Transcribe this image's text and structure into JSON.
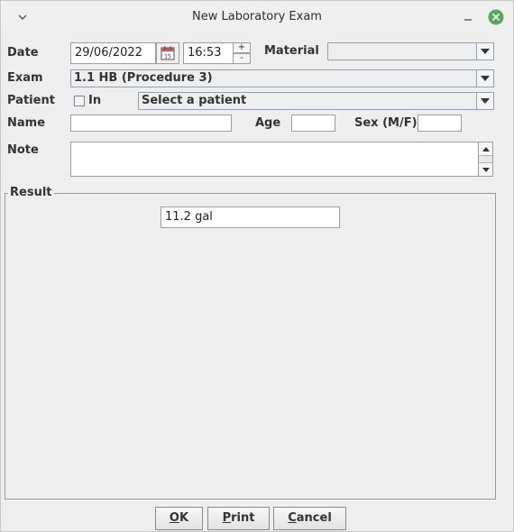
{
  "window": {
    "title": "New Laboratory Exam"
  },
  "labels": {
    "date": "Date",
    "material": "Material",
    "exam": "Exam",
    "patient": "Patient",
    "in": "In",
    "name": "Name",
    "age": "Age",
    "sex": "Sex (M/F)",
    "note": "Note",
    "result": "Result"
  },
  "fields": {
    "date": "29/06/2022",
    "time": "16:53",
    "material": "",
    "exam": "1.1 HB (Procedure 3)",
    "patient_select": "Select a patient",
    "name": "",
    "age": "",
    "sex": "",
    "note": "",
    "result": "11.2 gal"
  },
  "spinner": {
    "up": "+",
    "down": "-"
  },
  "buttons": {
    "ok_mnemonic": "O",
    "ok_rest": "K",
    "print_mnemonic": "P",
    "print_rest": "rint",
    "cancel_mnemonic": "C",
    "cancel_rest": "ancel"
  },
  "icons": {
    "collapse": "chevron-down-icon",
    "minimize": "minimize-icon",
    "close": "close-icon",
    "calendar": "calendar-icon",
    "dropdown": "dropdown-arrow-icon"
  }
}
